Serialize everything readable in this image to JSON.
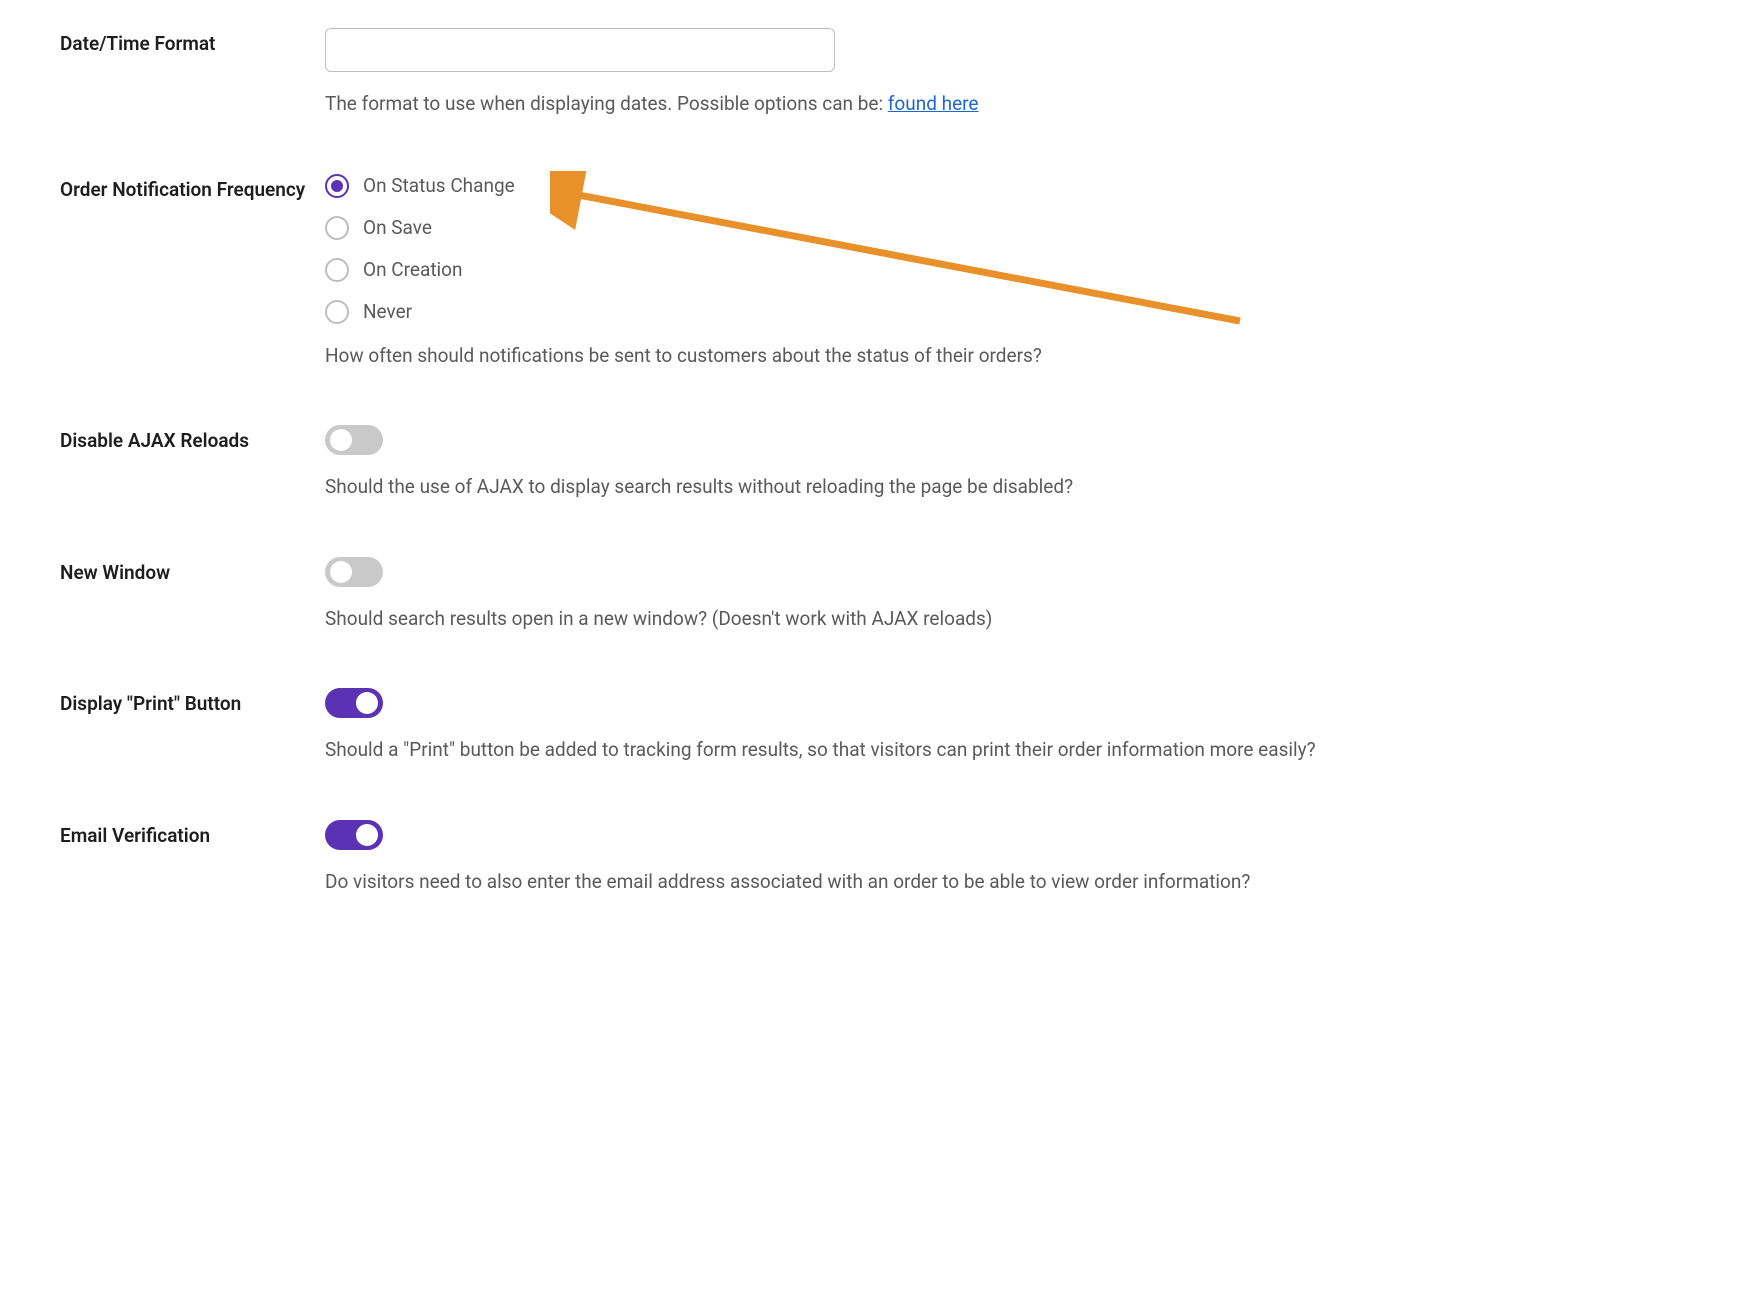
{
  "settings": {
    "date_time_format": {
      "label": "Date/Time Format",
      "value": "",
      "help_prefix": "The format to use when displaying dates. Possible options can be: ",
      "help_link_text": "found here"
    },
    "order_notification_frequency": {
      "label": "Order Notification Frequency",
      "options": [
        {
          "label": "On Status Change",
          "selected": true
        },
        {
          "label": "On Save",
          "selected": false
        },
        {
          "label": "On Creation",
          "selected": false
        },
        {
          "label": "Never",
          "selected": false
        }
      ],
      "help": "How often should notifications be sent to customers about the status of their orders?"
    },
    "disable_ajax": {
      "label": "Disable AJAX Reloads",
      "enabled": false,
      "help": "Should the use of AJAX to display search results without reloading the page be disabled?"
    },
    "new_window": {
      "label": "New Window",
      "enabled": false,
      "help": "Should search results open in a new window? (Doesn't work with AJAX reloads)"
    },
    "display_print": {
      "label": "Display \"Print\" Button",
      "enabled": true,
      "help": "Should a \"Print\" button be added to tracking form results, so that visitors can print their order information more easily?"
    },
    "email_verification": {
      "label": "Email Verification",
      "enabled": true,
      "help": "Do visitors need to also enter the email address associated with an order to be able to view order information?"
    }
  },
  "colors": {
    "accent": "#5b32b4",
    "arrow": "#e8912b"
  }
}
